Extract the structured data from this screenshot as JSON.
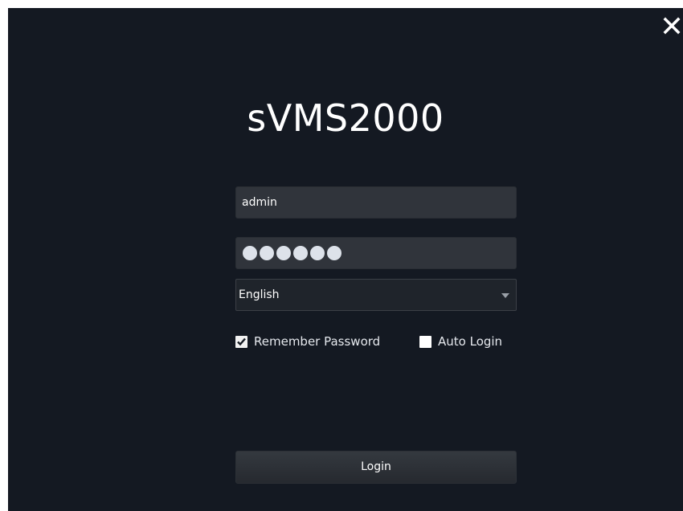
{
  "window": {
    "background": "#141922",
    "close_icon": "close-icon"
  },
  "app": {
    "title": "sVMS2000"
  },
  "login_form": {
    "username_value": "admin",
    "password_masked_length": 6,
    "language_selected": "English",
    "remember_password_label": "Remember Password",
    "remember_password_checked": true,
    "auto_login_label": "Auto Login",
    "auto_login_checked": false,
    "login_button_label": "Login"
  },
  "colors": {
    "input_background": "#30343b",
    "text": "#ffffff",
    "password_dot": "#dde2ea"
  }
}
